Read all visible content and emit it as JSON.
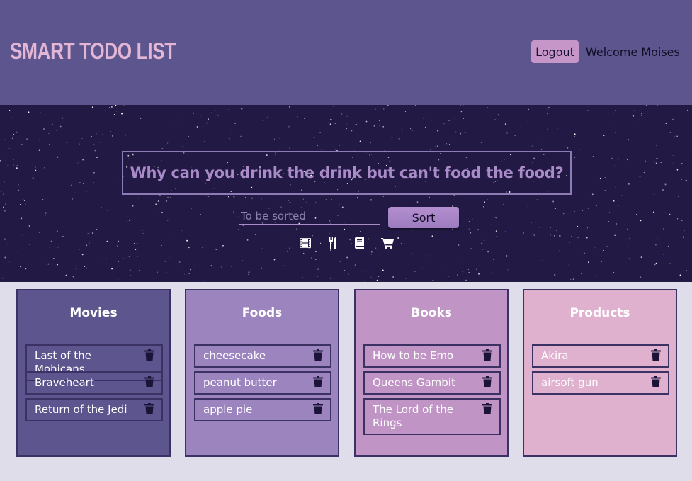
{
  "header": {
    "brand": "SMART TODO LIST",
    "logout_label": "Logout",
    "welcome_text": "Welcome Moises"
  },
  "hero": {
    "question": "Why can you drink the drink but can't food the food?",
    "input_placeholder": "To be sorted",
    "sort_label": "Sort",
    "category_icons": [
      "film-icon",
      "utensils-icon",
      "book-icon",
      "cart-icon"
    ]
  },
  "colors": {
    "header_bg": "#5d568e",
    "hero_bg": "#221a45",
    "movies_bg": "#5d568e",
    "foods_bg": "#9c84bf",
    "books_bg": "#c095c6",
    "products_bg": "#dfb1ce"
  },
  "lists": [
    {
      "title": "Movies",
      "items": [
        "Last of the Mohicans",
        "Braveheart",
        "Return of the Jedi"
      ]
    },
    {
      "title": "Foods",
      "items": [
        "cheesecake",
        "peanut butter",
        "apple pie"
      ]
    },
    {
      "title": "Books",
      "items": [
        "How to be Emo",
        "Queens Gambit",
        "The Lord of the Rings"
      ]
    },
    {
      "title": "Products",
      "items": [
        "Akira",
        "airsoft gun"
      ]
    }
  ]
}
